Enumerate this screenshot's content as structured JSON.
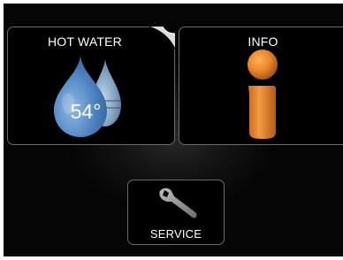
{
  "tiles": {
    "hot_water": {
      "label": "HOT WATER",
      "temperature": "54°",
      "icon": "water-drops-icon"
    },
    "info": {
      "label": "INFO",
      "icon": "info-icon"
    },
    "service": {
      "label": "SERVICE",
      "icon": "wrench-icon"
    }
  },
  "colors": {
    "drop_blue": "#5b8fc9",
    "info_orange": "#e8842a",
    "wrench_gray": "#9a9a9a"
  }
}
